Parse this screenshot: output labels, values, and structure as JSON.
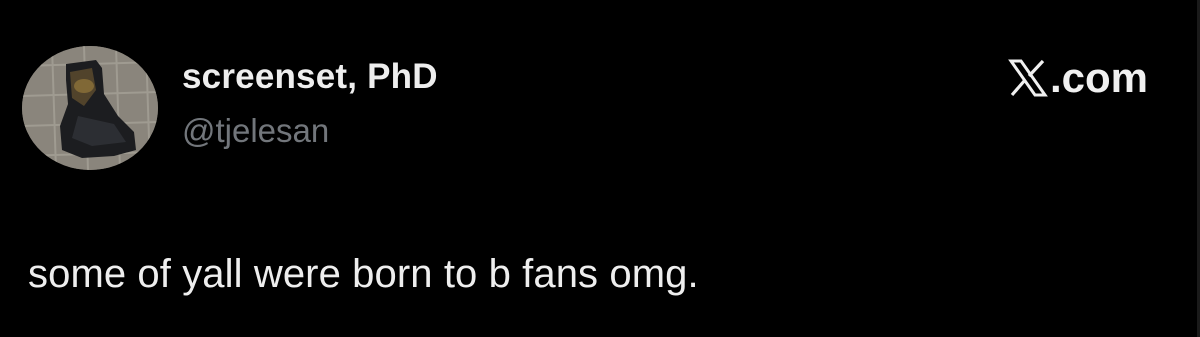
{
  "tweet": {
    "display_name": "screenset, PhD",
    "handle": "@tjelesan",
    "text": "some of yall were born to b fans omg.",
    "avatar_icon": "boot-photo-avatar"
  },
  "brand": {
    "icon": "x-logo-icon",
    "domain_suffix": ".com"
  },
  "colors": {
    "background": "#000000",
    "primary_text": "#eeeeee",
    "secondary_text": "#72767b"
  }
}
